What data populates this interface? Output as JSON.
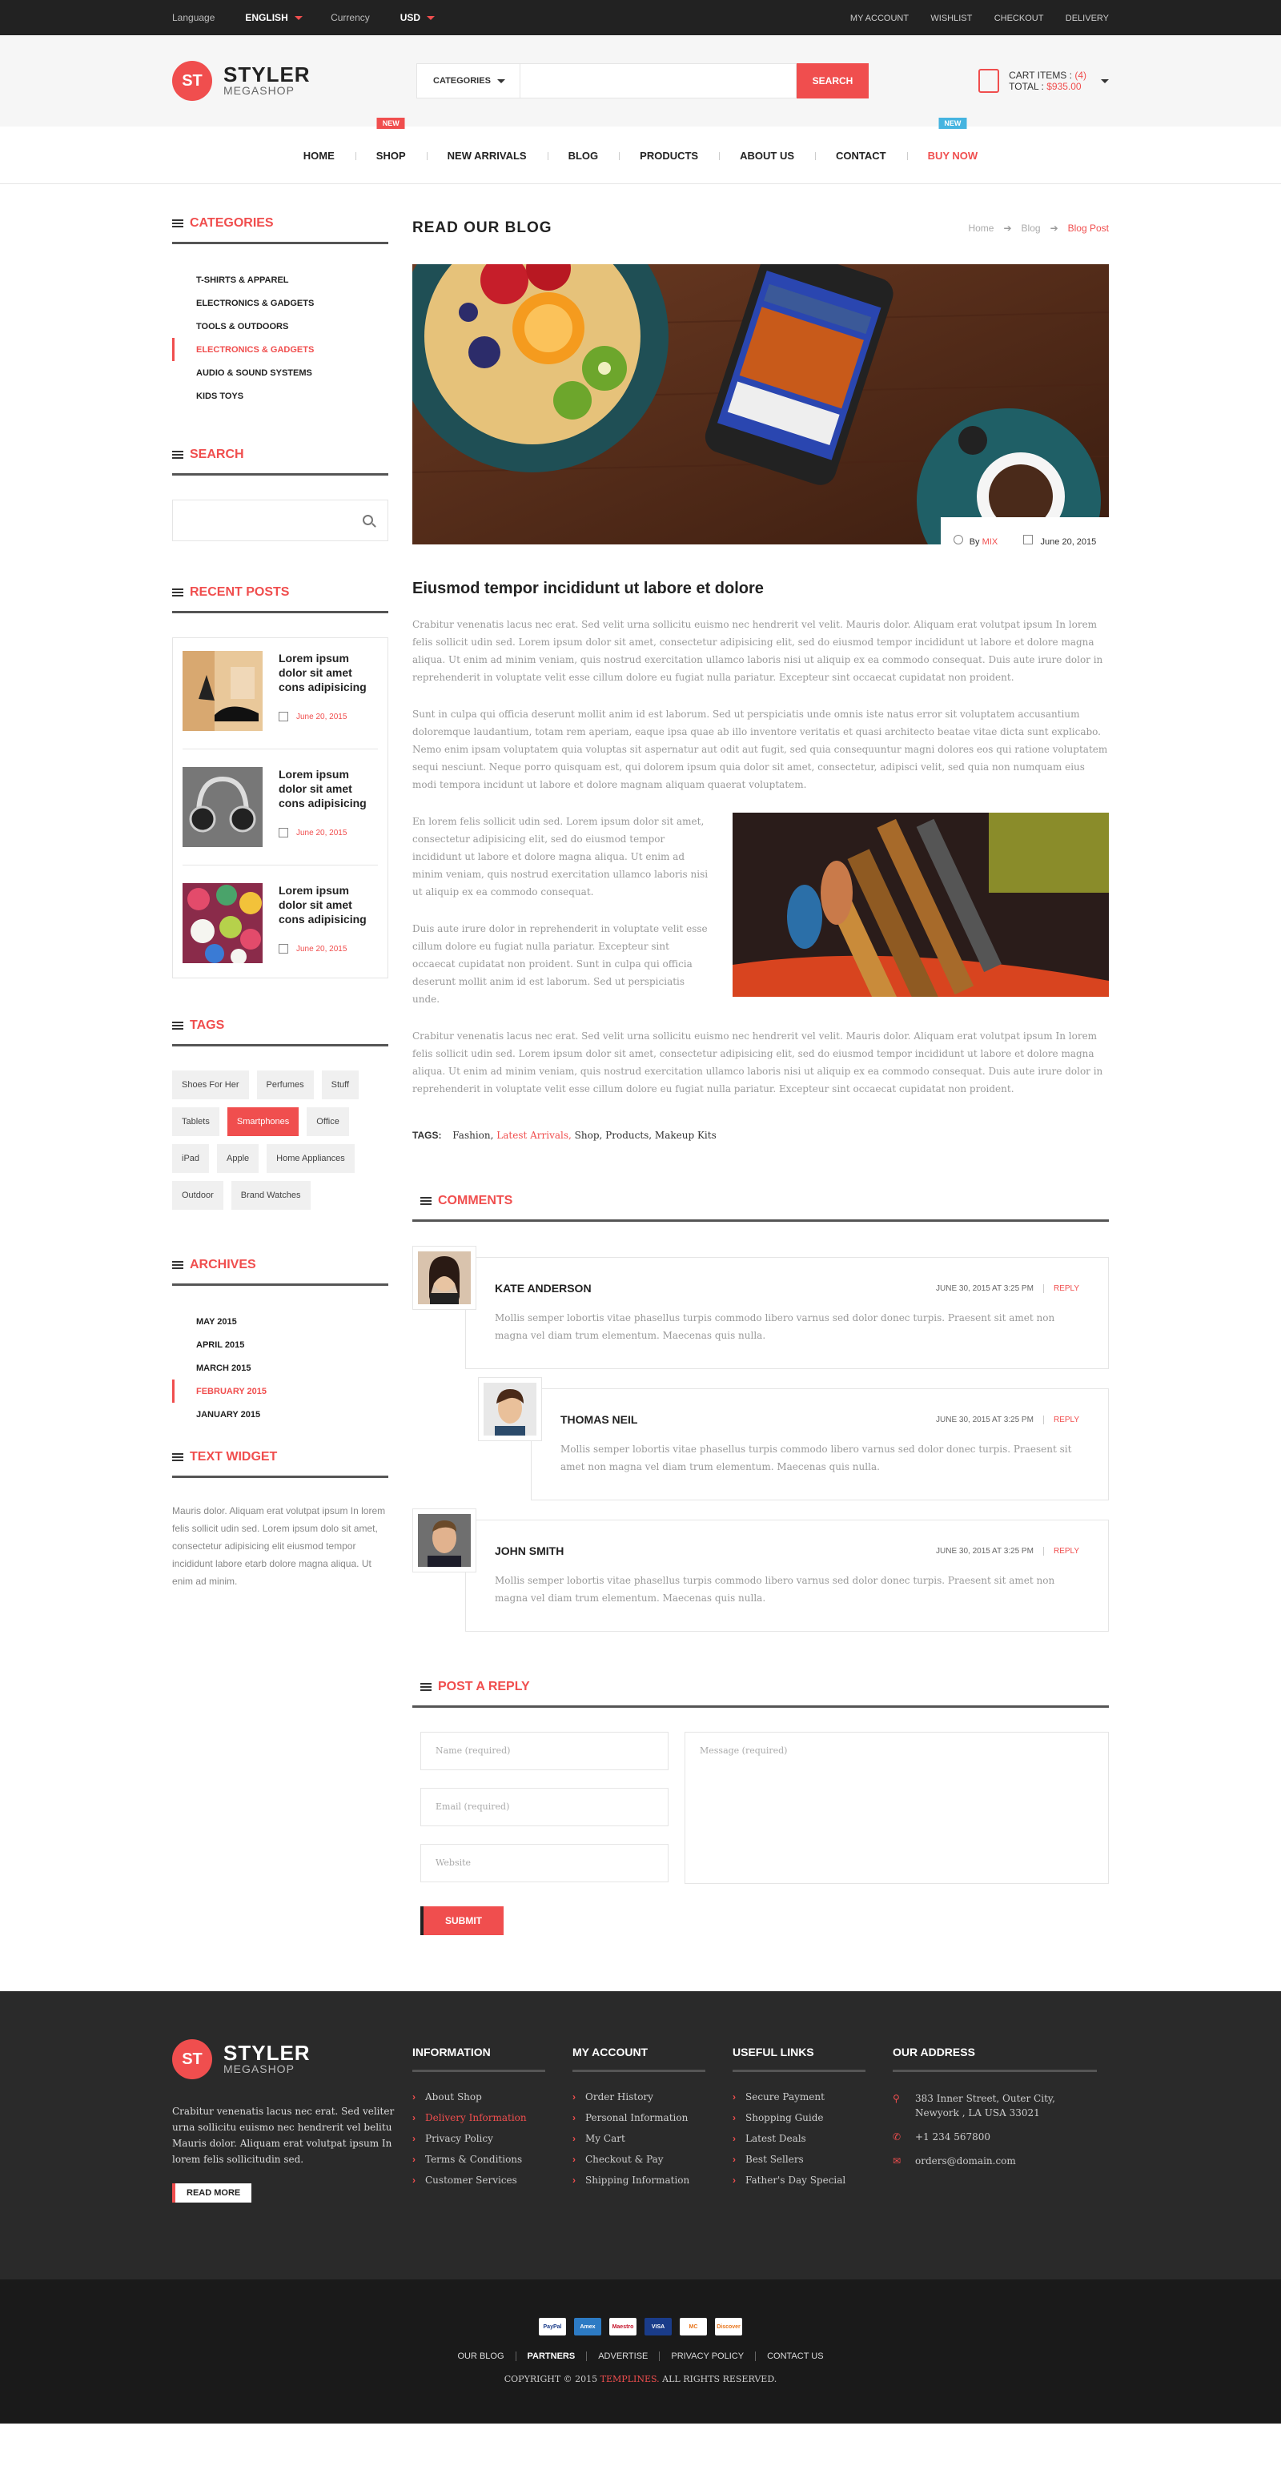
{
  "topbar": {
    "language_label": "Language",
    "language_value": "ENGLISH",
    "currency_label": "Currency",
    "currency_value": "USD",
    "links": [
      "MY ACCOUNT",
      "WISHLIST",
      "CHECKOUT",
      "DELIVERY"
    ]
  },
  "header": {
    "logo_mark": "ST",
    "logo_title": "STYLER",
    "logo_sub": "MEGASHOP",
    "search_category": "CATEGORIES",
    "search_button": "SEARCH",
    "cart_label": "CART ITEMS :",
    "cart_count": "(4)",
    "total_label": "TOTAL :",
    "total_value": "$935.00"
  },
  "nav": {
    "items": [
      "HOME",
      "SHOP",
      "NEW ARRIVALS",
      "BLOG",
      "PRODUCTS",
      "ABOUT US",
      "CONTACT",
      "BUY NOW"
    ],
    "badge_shop": "NEW",
    "badge_buy": "NEW"
  },
  "sidebar": {
    "categories_title": "CATEGORIES",
    "categories": [
      "T-SHIRTS & APPAREL",
      "ELECTRONICS & GADGETS",
      "TOOLS & OUTDOORS",
      "ELECTRONICS & GADGETS",
      "AUDIO & SOUND SYSTEMS",
      "KIDS TOYS"
    ],
    "search_title": "SEARCH",
    "recent_title": "RECENT POSTS",
    "recent": [
      {
        "title": "Lorem ipsum dolor sit amet cons adipisicing",
        "date": "June 20, 2015"
      },
      {
        "title": "Lorem ipsum dolor sit amet cons adipisicing",
        "date": "June 20, 2015"
      },
      {
        "title": "Lorem ipsum dolor sit amet cons adipisicing",
        "date": "June 20, 2015"
      }
    ],
    "tags_title": "TAGS",
    "tags": [
      "Shoes For Her",
      "Perfumes",
      "Stuff",
      "Tablets",
      "Smartphones",
      "Office",
      "iPad",
      "Apple",
      "Home Appliances",
      "Outdoor",
      "Brand Watches"
    ],
    "archives_title": "ARCHIVES",
    "archives": [
      "MAY 2015",
      "APRIL 2015",
      "MARCH 2015",
      "FEBRUARY 2015",
      "JANUARY 2015"
    ],
    "text_title": "TEXT WIDGET",
    "text": "Mauris dolor. Aliquam erat volutpat ipsum In lorem felis sollicit udin sed. Lorem ipsum dolo sit amet, consectetur adipisicing elit eiusmod tempor incididunt labore etarb dolore magna aliqua. Ut enim ad minim."
  },
  "content": {
    "page_title": "READ OUR BLOG",
    "crumbs": [
      "Home",
      "Blog",
      "Blog Post"
    ],
    "meta_by": "By",
    "meta_author": "MIX",
    "meta_date": "June 20, 2015",
    "post_title": "Eiusmod tempor incididunt ut labore et dolore",
    "p1": "Crabitur venenatis lacus nec erat. Sed velit urna sollicitu euismo nec hendrerit vel velit. Mauris dolor. Aliquam erat volutpat ipsum In lorem felis sollicit udin sed. Lorem ipsum dolor sit amet, consectetur adipisicing elit, sed do eiusmod tempor incididunt ut labore et dolore magna aliqua. Ut enim ad minim veniam, quis nostrud exercitation ullamco laboris nisi ut aliquip ex ea commodo consequat. Duis aute irure dolor in reprehenderit in voluptate velit esse cillum dolore eu fugiat nulla pariatur. Excepteur sint occaecat cupidatat non proident.",
    "p2": "Sunt in culpa qui officia deserunt mollit anim id est laborum. Sed ut perspiciatis unde omnis iste natus error sit voluptatem accusantium doloremque laudantium, totam rem aperiam, eaque ipsa quae ab illo inventore veritatis et quasi architecto beatae vitae dicta sunt explicabo. Nemo enim ipsam voluptatem quia voluptas sit aspernatur aut odit aut fugit, sed quia consequuntur magni dolores eos qui ratione voluptatem sequi nesciunt. Neque porro quisquam est, qui dolorem ipsum quia dolor sit amet, consectetur, adipisci velit, sed quia non numquam eius modi tempora incidunt ut labore et dolore magnam aliquam quaerat voluptatem.",
    "p3": "En lorem felis sollicit udin sed. Lorem ipsum dolor sit amet, consectetur adipisicing elit, sed do eiusmod tempor incididunt ut labore et dolore magna aliqua. Ut enim ad minim veniam, quis nostrud exercitation ullamco laboris nisi ut aliquip ex ea commodo consequat.",
    "p4": "Duis aute irure dolor in reprehenderit in voluptate velit esse cillum dolore eu fugiat nulla pariatur. Excepteur sint occaecat cupidatat non proident. Sunt in culpa qui officia deserunt mollit anim id est laborum. Sed ut perspiciatis unde.",
    "p5": "Crabitur venenatis lacus nec erat. Sed velit urna sollicitu euismo nec hendrerit vel velit. Mauris dolor. Aliquam erat volutpat ipsum In lorem felis sollicit udin sed. Lorem ipsum dolor sit amet, consectetur adipisicing elit, sed do eiusmod tempor incididunt ut labore et dolore magna aliqua. Ut enim ad minim veniam, quis nostrud exercitation ullamco laboris nisi ut aliquip ex ea commodo consequat. Duis aute irure dolor in reprehenderit in voluptate velit esse cillum dolore eu fugiat nulla pariatur. Excepteur sint occaecat cupidatat non proident.",
    "tags_label": "TAGS:",
    "tags": [
      "Fashion,",
      "Latest Arrivals,",
      "Shop, Products, Makeup Kits"
    ],
    "comments_title": "COMMENTS",
    "comments": [
      {
        "name": "KATE ANDERSON",
        "date": "JUNE 30, 2015 AT 3:25 PM",
        "reply": "REPLY",
        "text": "Mollis semper lobortis vitae phasellus turpis commodo libero varnus sed dolor donec turpis. Praesent sit amet non magna vel diam trum elementum. Maecenas quis nulla."
      },
      {
        "name": "THOMAS NEIL",
        "date": "JUNE 30, 2015 AT 3:25 PM",
        "reply": "REPLY",
        "text": "Mollis semper lobortis vitae phasellus turpis commodo libero varnus sed dolor donec turpis. Praesent sit amet non magna vel diam trum elementum. Maecenas quis nulla."
      },
      {
        "name": "JOHN SMITH",
        "date": "JUNE 30, 2015 AT 3:25 PM",
        "reply": "REPLY",
        "text": "Mollis semper lobortis vitae phasellus turpis commodo libero varnus sed dolor donec turpis. Praesent sit amet non magna vel diam trum elementum. Maecenas quis nulla."
      }
    ],
    "reply_title": "POST A REPLY",
    "form": {
      "name": "Name (required)",
      "email": "Email (required)",
      "website": "Website",
      "message": "Message (required)",
      "submit": "SUBMIT"
    }
  },
  "footer": {
    "about": "Crabitur venenatis lacus nec erat. Sed veliter urna sollicitu euismo nec hendrerit vel belitu Mauris dolor. Aliquam erat volutpat ipsum In lorem felis sollicitudin sed.",
    "read_more": "READ MORE",
    "info_title": "INFORMATION",
    "info": [
      "About Shop",
      "Delivery Information",
      "Privacy Policy",
      "Terms & Conditions",
      "Customer Services"
    ],
    "account_title": "MY ACCOUNT",
    "account": [
      "Order History",
      "Personal Information",
      "My Cart",
      "Checkout & Pay",
      "Shipping Information"
    ],
    "links_title": "USEFUL LINKS",
    "links": [
      "Secure Payment",
      "Shopping Guide",
      "Latest Deals",
      "Best Sellers",
      "Father's Day Special"
    ],
    "address_title": "OUR ADDRESS",
    "address": "383 Inner Street, Outer City, Newyork , LA USA 33021",
    "phone": "+1 234 567800",
    "email": "orders@domain.com",
    "cards": [
      "PayPal",
      "Amex",
      "Maestro",
      "VISA",
      "MC",
      "Discover"
    ],
    "bottom_links": [
      "OUR BLOG",
      "PARTNERS",
      "ADVERTISE",
      "PRIVACY POLICY",
      "CONTACT US"
    ],
    "copyright_pre": "COPYRIGHT © 2015",
    "copyright_brand": "TEMPLINES.",
    "copyright_post": "ALL RIGHTS RESERVED."
  },
  "colors": {
    "accent": "#f04e4e",
    "dark": "#222222",
    "badge_blue": "#45b4e0"
  }
}
